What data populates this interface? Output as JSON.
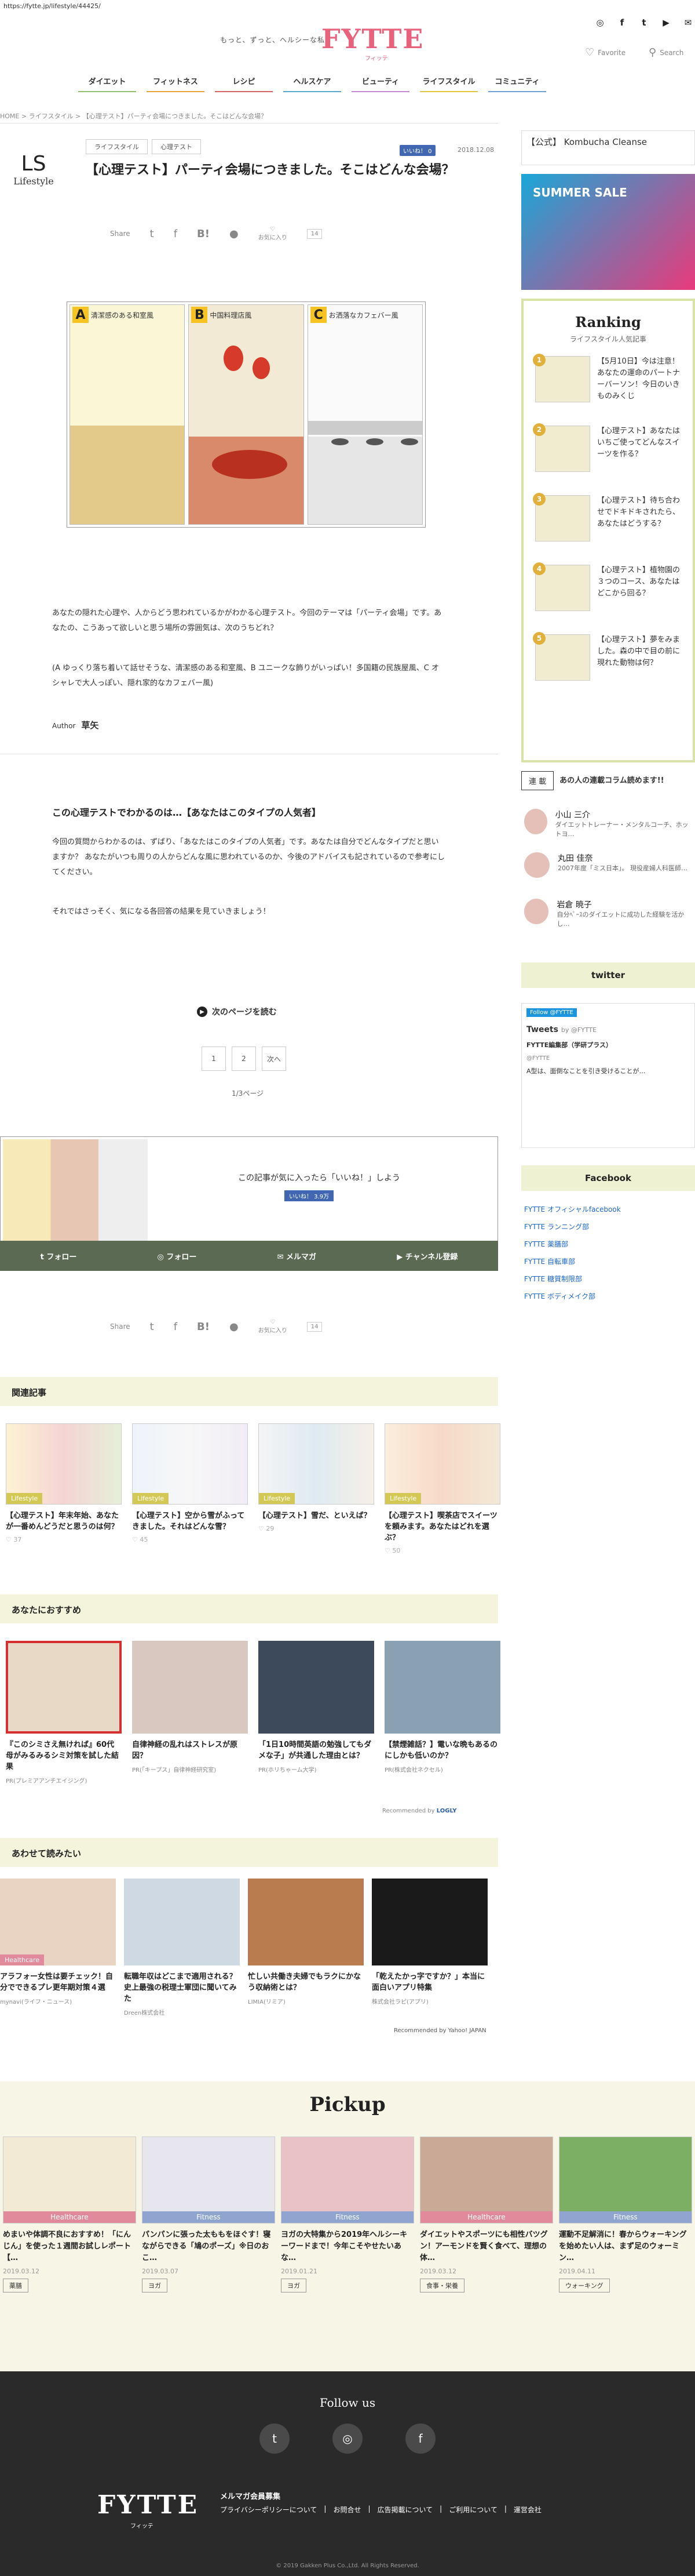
{
  "url": "https://fytte.jp/lifestyle/44425/",
  "header": {
    "tagline": "もっと、ずっと、ヘルシーな私",
    "logo": "FYTTE",
    "logo_sub": "フィッテ",
    "favorite": "Favorite",
    "search": "Search",
    "social": [
      "instagram-icon",
      "facebook-icon",
      "twitter-icon",
      "youtube-icon",
      "email-icon"
    ]
  },
  "nav": [
    "ダイエット",
    "フィットネス",
    "レシピ",
    "ヘルスケア",
    "ビューティ",
    "ライフスタイル",
    "コミュニティ"
  ],
  "breadcrumb": "HOME  >  ライフスタイル  >  【心理テスト】パーティ会場につきました。そこはどんな会場？",
  "category": {
    "glyph": "LS",
    "label": "Lifestyle"
  },
  "tags": [
    "ライフスタイル",
    "心理テスト"
  ],
  "fb_like": "いいね！ 0",
  "date": "2018.12.08",
  "title": "【心理テスト】パーティ会場につきました。そこはどんな会場？",
  "share": {
    "label": "Share",
    "fav_label": "お気に入り",
    "count": "14"
  },
  "illustration": {
    "panels": [
      {
        "letter": "A",
        "caption": "清潔感のある和室風"
      },
      {
        "letter": "B",
        "caption": "中国料理店風"
      },
      {
        "letter": "C",
        "caption": "お洒落なカフェバー風"
      }
    ]
  },
  "body": {
    "p1": "あなたの隠れた心理や、人からどう思われているかがわかる心理テスト。今回のテーマは「パーティ会場」です。あなたの、こうあって欲しいと思う場所の雰囲気は、次のうちどれ？",
    "p2": "(A ゆっくり落ち着いて話せそうな、清潔感のある和室風、B ユニークな飾りがいっぱい！多国籍の民族屋風、C オシャレで大人っぽい、隠れ家的なカフェバー風)",
    "author_label": "Author",
    "author": "草矢",
    "h2": "この心理テストでわかるのは…【あなたはこのタイプの人気者】",
    "p3": "今回の質問からわかるのは、ずばり、「あなたはこのタイプの人気者」です。あなたは自分でどんなタイプだと思いますか？ あなたがいつも周りの人からどんな風に思われているのか、今後のアドバイスも記されているので参考にしてください。",
    "p4": "それではさっそく、気になる各回答の結果を見ていきましょう！"
  },
  "pagination": {
    "read_next": "次のページを読む",
    "pages": [
      "1",
      "2",
      "次へ"
    ],
    "count": "1/3ページ"
  },
  "likebox": {
    "text": "この記事が気に入ったら「いいね！」しよう",
    "fb": "いいね！ 3.9万"
  },
  "follow_bar": [
    "フォロー",
    "フォロー",
    "メルマガ",
    "チャンネル登録"
  ],
  "related": {
    "heading": "関連記事",
    "items": [
      {
        "badge": "Lifestyle",
        "title": "【心理テスト】年末年始、あなたが一番めんどうだと思うのは何？",
        "meta": "♡ 37"
      },
      {
        "badge": "Lifestyle",
        "title": "【心理テスト】空から雪がふってきました。それはどんな雪？",
        "meta": "♡ 45"
      },
      {
        "badge": "Lifestyle",
        "title": "【心理テスト】雪だ、といえば？",
        "meta": "♡ 29"
      },
      {
        "badge": "Lifestyle",
        "title": "【心理テスト】喫茶店でスイーツを頼みます。あなたはどれを選ぶ？",
        "meta": "♡ 50"
      }
    ]
  },
  "recommend": {
    "heading": "あなたにおすすめ",
    "items": [
      {
        "title": "『このシミさえ無ければ』60代母がみるみるシミ対策を試した結果",
        "src": "PR(プレミアアンチエイジング)"
      },
      {
        "title": "自律神経の乱れはストレスが原因？",
        "src": "PR(「キープス」自律神経研究室)"
      },
      {
        "title": "「1日10時間英語の勉強してもダメな子」が共通した理由とは？",
        "src": "PR(ホリちゃーム大学)"
      },
      {
        "title": "【禁煙雑話？】電いな晩もあるのにしかも低いのか？",
        "src": "PR(株式会社ネクセル)"
      }
    ],
    "footer": "Recommended by",
    "brand": "LOGLY"
  },
  "also": {
    "heading": "あわせて読みたい",
    "items": [
      {
        "badge": "Healthcare",
        "title": "アラフォー女性は要チェック！自分でできるプレ更年期対策４選",
        "src": "mynavi(ライフ・ニュース)"
      },
      {
        "title": "転職年収はどこまで適用される？ 史上最強の税理士軍団に聞いてみた",
        "src": "Dreen株式会社"
      },
      {
        "title": "忙しい共働き夫婦でもラクにかなう収納術とは？",
        "src": "LIMIA(リミア)"
      },
      {
        "title": "「乾えたかっ字ですか？」本当に面白いアプリ特集",
        "src": "株式会社ラピ(アプリ)"
      }
    ],
    "footer": "Recommended by Yahoo! JAPAN"
  },
  "pickup": {
    "heading": "Pickup",
    "items": [
      {
        "badge": "Healthcare",
        "color": "#e08a9b",
        "title": "めまいや体調不良におすすめ！「にんじん」を使った１週間お試しレポート【…",
        "date": "2019.03.12",
        "tag": "薬膳"
      },
      {
        "badge": "Fitness",
        "color": "#8fa5cf",
        "title": "パンパンに張った太ももをほぐす！寝ながらできる「鳩のポーズ」※日のおこ…",
        "date": "2019.03.07",
        "tag": "ヨガ"
      },
      {
        "badge": "Fitness",
        "color": "#8fa5cf",
        "title": "ヨガの大特集から2019年ヘルシーキーワードまで！今年こそやせたいあな…",
        "date": "2019.01.21",
        "tag": "ヨガ"
      },
      {
        "badge": "Healthcare",
        "color": "#e08a9b",
        "title": "ダイエットやスポーツにも相性バツグン！アーモンドを賢く食べて、理想の体…",
        "date": "2019.03.12",
        "tag": "食事・栄養"
      },
      {
        "badge": "Fitness",
        "color": "#8fa5cf",
        "title": "運動不足解消に！春からウォーキングを始めたい人は、まず足のウォーミン…",
        "date": "2019.04.11",
        "tag": "ウォーキング"
      }
    ]
  },
  "sidebar": {
    "ad1": "【公式】 Kombucha Cleanse",
    "ad2": "SUMMER SALE",
    "ranking": {
      "title": "Ranking",
      "sub": "ライフスタイル人気記事",
      "items": [
        "【5月10日】今は注意！あなたの運命のパートナーバーソン！今日のいきものみくじ",
        "【心理テスト】あなたはいちご使ってどんなスイーツを作る？",
        "【心理テスト】待ち合わせでドキドキされたら、あなたはどうする？",
        "【心理テスト】植物園の３つのコース、あなたはどこから回る？",
        "【心理テスト】夢をみました。森の中で目の前に現れた動物は何？"
      ]
    },
    "column": {
      "box": "連 載",
      "title": "あの人の連載コラム読めます!!",
      "writers": [
        {
          "name": "小山 三介",
          "desc": "ダイエットトレーナー・メンタルコーチ、ホットヨ…"
        },
        {
          "name": "丸田 佳奈",
          "desc": "2007年度「ミス日本」。 現役産婦人科医師…"
        },
        {
          "name": "岩倉 暁子",
          "desc": "自分ﾍﾟｰｽのダイエットに成功した経験を活かし…"
        }
      ]
    },
    "twitter": "twitter",
    "tweets": {
      "follow": "Follow @FYTTE",
      "label": "Tweets",
      "by": "by @FYTTE",
      "account": "FYTTE編集部（学研プラス）",
      "handle": "@FYTTE",
      "text": "A型は、面倒なことを引き受けることが…"
    },
    "facebook": "Facebook",
    "fb_links": [
      "FYTTE オフィシャルfacebook",
      "FYTTE ランニング部",
      "FYTTE 薬膳部",
      "FYTTE 自転車部",
      "FYTTE 糖質制限部",
      "FYTTE ボディメイク部"
    ]
  },
  "footer": {
    "follow": "Follow us",
    "icons": [
      "twitter-icon",
      "instagram-icon",
      "facebook-icon"
    ],
    "logo": "FYTTE",
    "logo_sub": "フィッテ",
    "links": [
      "メルマガ会員募集",
      "プライバシーポリシーについて",
      "お問合せ",
      "広告掲載について",
      "ご利用について",
      "運営会社"
    ],
    "copy": "© 2019 Gakken Plus Co.,Ltd. All Rights Reserved."
  }
}
